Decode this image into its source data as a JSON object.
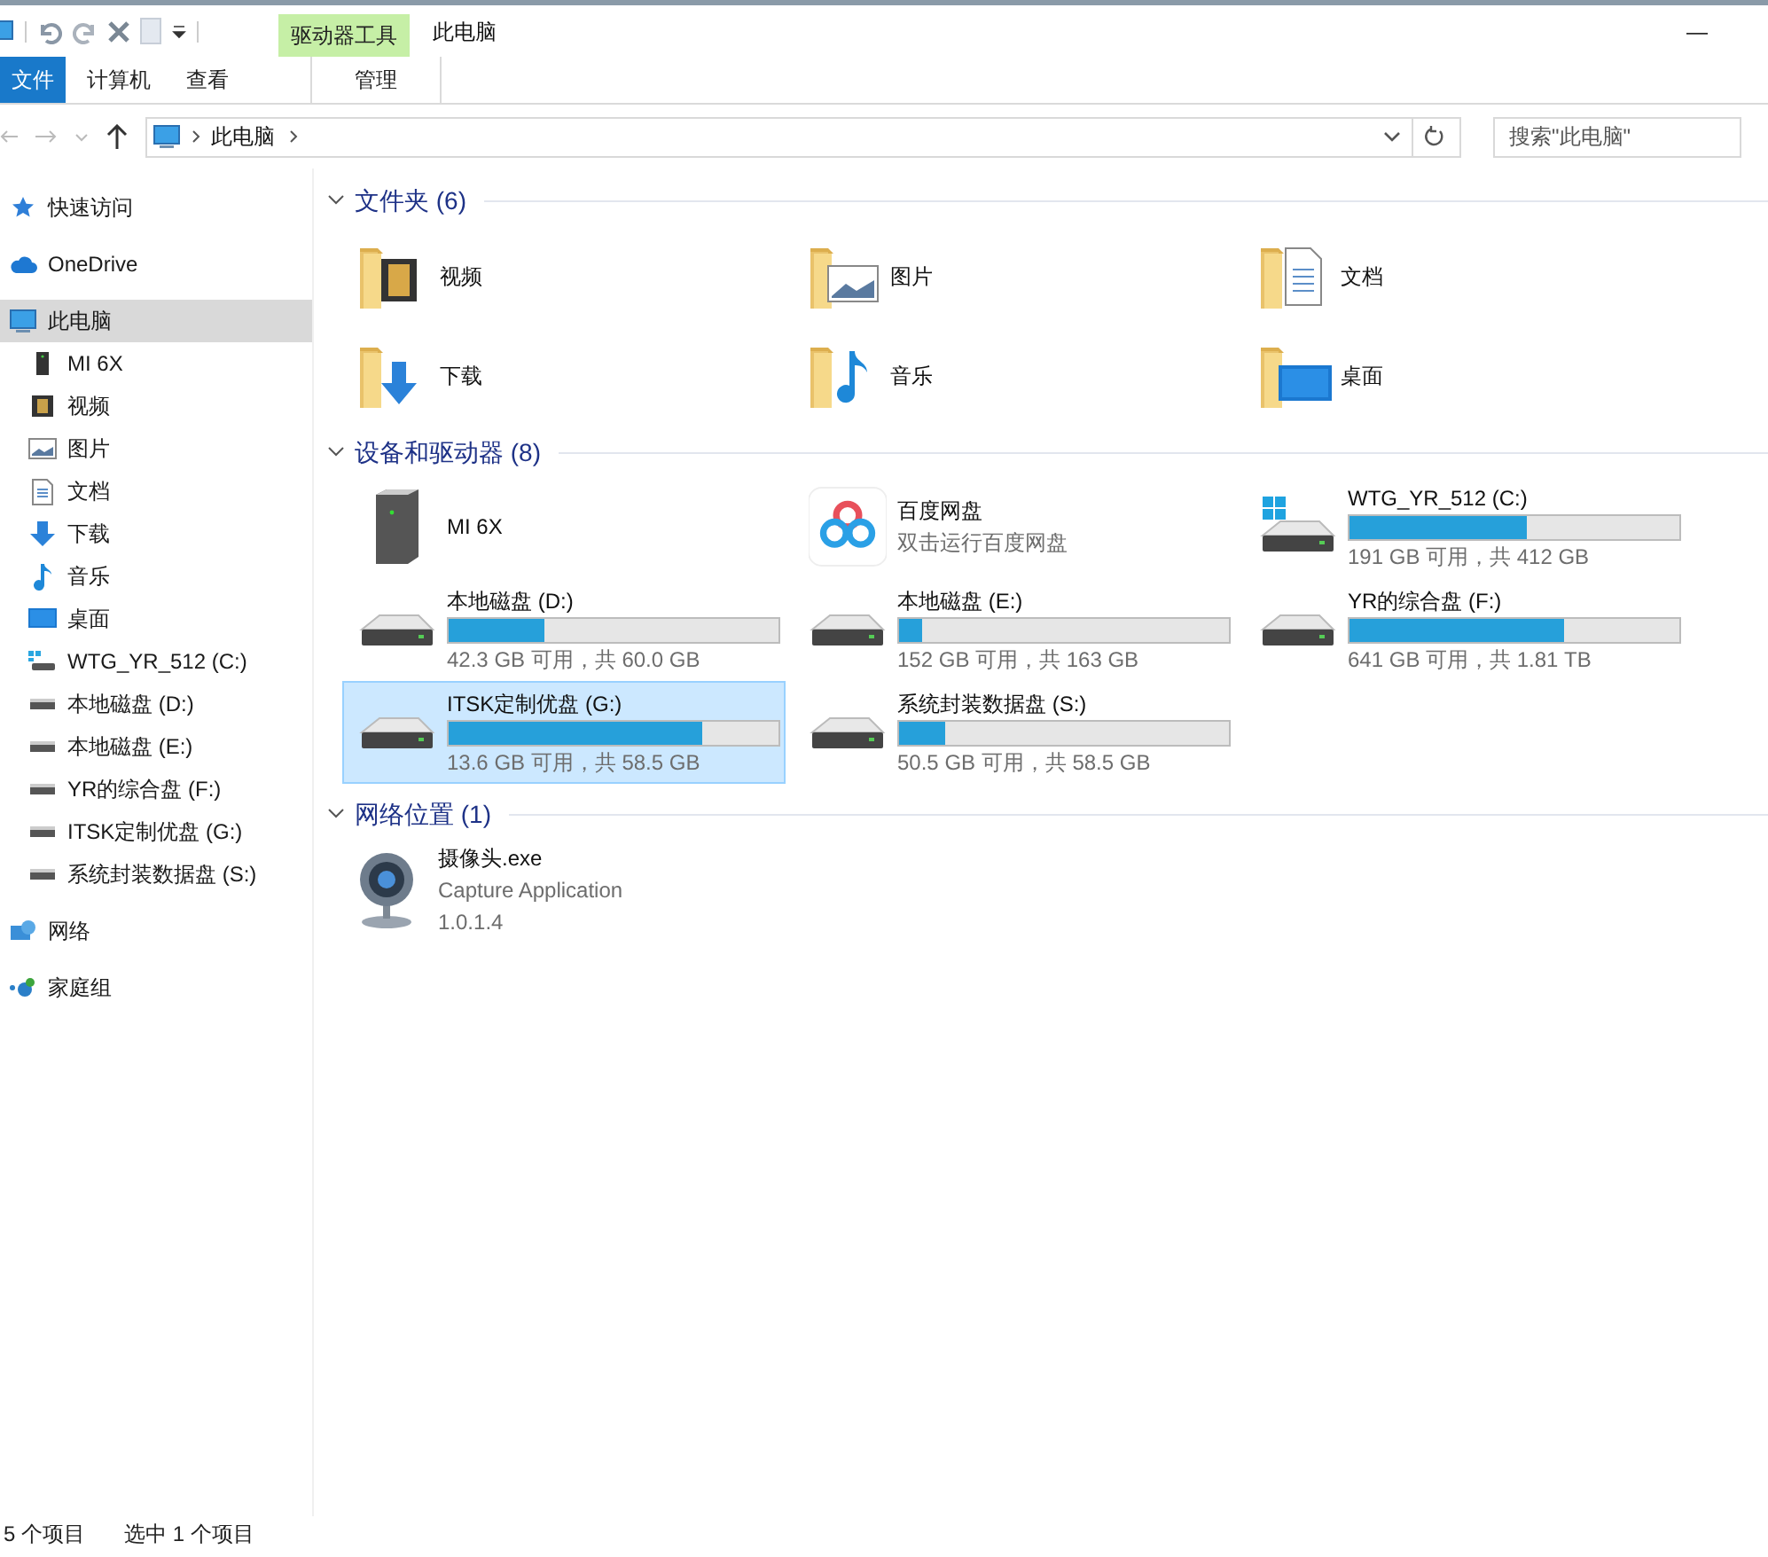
{
  "window": {
    "title": "此电脑",
    "contextual_group": "驱动器工具",
    "minimize": "—"
  },
  "ribbon_tabs": [
    {
      "label": "文件",
      "kind": "file"
    },
    {
      "label": "计算机",
      "kind": "normal"
    },
    {
      "label": "查看",
      "kind": "normal"
    },
    {
      "label": "管理",
      "kind": "contextual"
    }
  ],
  "address_bar": {
    "crumbs": [
      "此电脑"
    ],
    "search_placeholder": "搜索\"此电脑\""
  },
  "sidebar": {
    "items": [
      {
        "label": "快速访问",
        "kind": "star",
        "selected": false
      },
      {
        "label": "OneDrive",
        "kind": "cloud",
        "selected": false
      },
      {
        "label": "此电脑",
        "kind": "computer",
        "selected": true,
        "children": [
          {
            "label": "MI 6X",
            "kind": "phone",
            "selected": false
          },
          {
            "label": "视频",
            "kind": "video",
            "selected": false
          },
          {
            "label": "图片",
            "kind": "pictures",
            "selected": false
          },
          {
            "label": "文档",
            "kind": "documents",
            "selected": false
          },
          {
            "label": "下载",
            "kind": "downloads",
            "selected": false
          },
          {
            "label": "音乐",
            "kind": "music",
            "selected": false
          },
          {
            "label": "桌面",
            "kind": "desktop",
            "selected": false
          },
          {
            "label": "WTG_YR_512 (C:)",
            "kind": "system-drive",
            "selected": false
          },
          {
            "label": "本地磁盘 (D:)",
            "kind": "drive",
            "selected": false
          },
          {
            "label": "本地磁盘 (E:)",
            "kind": "drive",
            "selected": false
          },
          {
            "label": "YR的综合盘 (F:)",
            "kind": "drive",
            "selected": false
          },
          {
            "label": "ITSK定制优盘 (G:)",
            "kind": "drive",
            "selected": false
          },
          {
            "label": "系统封装数据盘 (S:)",
            "kind": "drive",
            "selected": false
          }
        ]
      },
      {
        "label": "网络",
        "kind": "network",
        "selected": false
      },
      {
        "label": "家庭组",
        "kind": "homegroup",
        "selected": false
      }
    ]
  },
  "folders": {
    "title": "文件夹 (6)",
    "items": [
      {
        "name": "视频",
        "kind": "video"
      },
      {
        "name": "图片",
        "kind": "pictures"
      },
      {
        "name": "文档",
        "kind": "documents"
      },
      {
        "name": "下载",
        "kind": "downloads"
      },
      {
        "name": "音乐",
        "kind": "music"
      },
      {
        "name": "桌面",
        "kind": "desktop"
      }
    ]
  },
  "devices": {
    "title": "设备和驱动器 (8)",
    "items": [
      {
        "name": "MI 6X",
        "kind": "phone",
        "selected": false
      },
      {
        "name": "百度网盘",
        "kind": "app",
        "subtitle": "双击运行百度网盘",
        "selected": false
      },
      {
        "name": "WTG_YR_512 (C:)",
        "kind": "system-drive",
        "level": 0.54,
        "space": "191 GB 可用，共 412 GB",
        "selected": false
      },
      {
        "name": "本地磁盘 (D:)",
        "kind": "drive",
        "level": 0.29,
        "space": "42.3 GB 可用，共 60.0 GB",
        "selected": false
      },
      {
        "name": "本地磁盘 (E:)",
        "kind": "drive",
        "level": 0.07,
        "space": "152 GB 可用，共 163 GB",
        "selected": false
      },
      {
        "name": "YR的综合盘 (F:)",
        "kind": "drive",
        "level": 0.65,
        "space": "641 GB 可用，共 1.81 TB",
        "selected": false
      },
      {
        "name": "ITSK定制优盘 (G:)",
        "kind": "drive",
        "level": 0.77,
        "space": "13.6 GB 可用，共 58.5 GB",
        "selected": true
      },
      {
        "name": "系统封装数据盘 (S:)",
        "kind": "drive",
        "level": 0.14,
        "space": "50.5 GB 可用，共 58.5 GB",
        "selected": false
      }
    ]
  },
  "network": {
    "title": "网络位置 (1)",
    "items": [
      {
        "name": "摄像头.exe",
        "description": "Capture Application",
        "version": "1.0.1.4"
      }
    ]
  },
  "status_bar": {
    "count": "5 个项目",
    "selection": "选中 1 个项目"
  }
}
